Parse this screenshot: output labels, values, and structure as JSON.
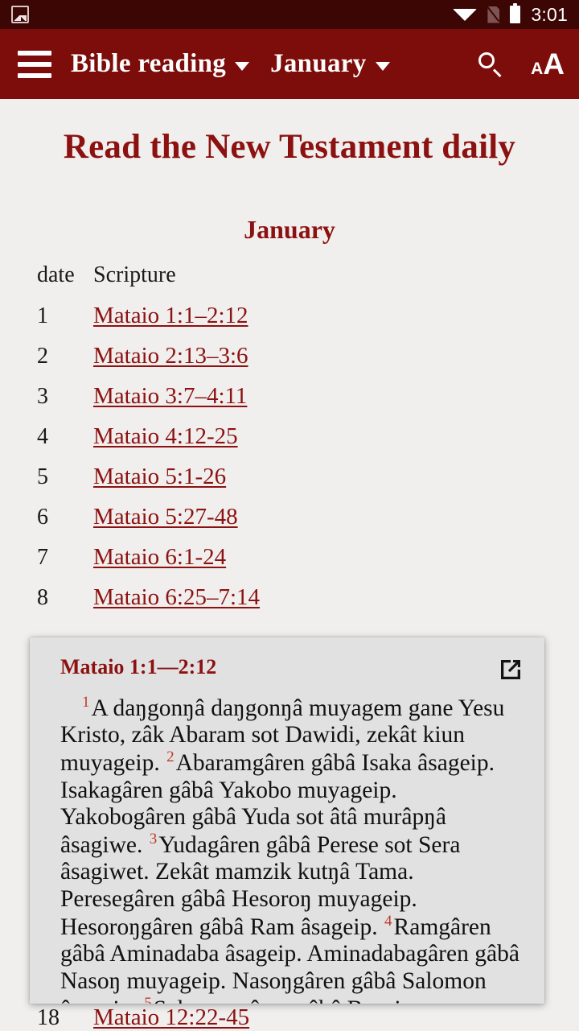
{
  "status_bar": {
    "time": "3:01",
    "icons": [
      "image-notification-icon",
      "wifi-icon",
      "no-sim-icon",
      "battery-icon"
    ]
  },
  "toolbar": {
    "menu_icon": "hamburger-menu-icon",
    "publication_label": "Bible reading",
    "month_label": "January",
    "search_icon": "search-icon",
    "text_size_small": "A",
    "text_size_big": "A",
    "accent_color": "#7d0d0b"
  },
  "page": {
    "title": "Read the New Testament daily",
    "month": "January",
    "columns": [
      "date",
      "Scripture"
    ],
    "rows": [
      {
        "date": "1",
        "scripture": "Mataio 1:1–2:12"
      },
      {
        "date": "2",
        "scripture": "Mataio 2:13–3:6"
      },
      {
        "date": "3",
        "scripture": "Mataio 3:7–4:11"
      },
      {
        "date": "4",
        "scripture": "Mataio 4:12-25"
      },
      {
        "date": "5",
        "scripture": "Mataio 5:1-26"
      },
      {
        "date": "6",
        "scripture": "Mataio 5:27-48"
      },
      {
        "date": "7",
        "scripture": "Mataio 6:1-24"
      },
      {
        "date": "8",
        "scripture": "Mataio 6:25–7:14"
      }
    ],
    "bottom_row": {
      "date": "18",
      "scripture": "Mataio 12:22-45"
    }
  },
  "verse_card": {
    "title": "Mataio 1:1—2:12",
    "open_icon": "open-in-new-window-icon",
    "verses": [
      {
        "num": "1",
        "text": "A daŋgonŋâ daŋgonŋâ muyagem gane Yesu Kristo, zâk Abaram sot Dawidi, zekât kiun muyageip."
      },
      {
        "num": "2",
        "text": "Abaramgâren gâbâ Isaka âsageip. Isakagâren gâbâ Yakobo muyageip. Yakobogâren gâbâ Yuda sot âtâ murâpŋâ âsagiwe."
      },
      {
        "num": "3",
        "text": "Yudagâren gâbâ Perese sot Sera âsagiwet. Zekât mamzik kutŋâ Tama. Peresegâren gâbâ Hesoroŋ muyageip. Hesoroŋgâren gâbâ Ram âsageip."
      },
      {
        "num": "4",
        "text": "Ramgâren gâbâ Aminadaba âsageip. Aminadabagâren gâbâ Nasoŋ muyageip. Nasoŋgâren gâbâ Salomon âsageip."
      },
      {
        "num": "5",
        "text": "Salomongâren gâbâ Boasi"
      }
    ]
  },
  "colors": {
    "status_bar": "#3c0605",
    "toolbar": "#7d0d0b",
    "page_background": "#f0efed",
    "card_background": "#e1e1e1",
    "link": "#8c1111",
    "verse_number": "#c0392b"
  }
}
